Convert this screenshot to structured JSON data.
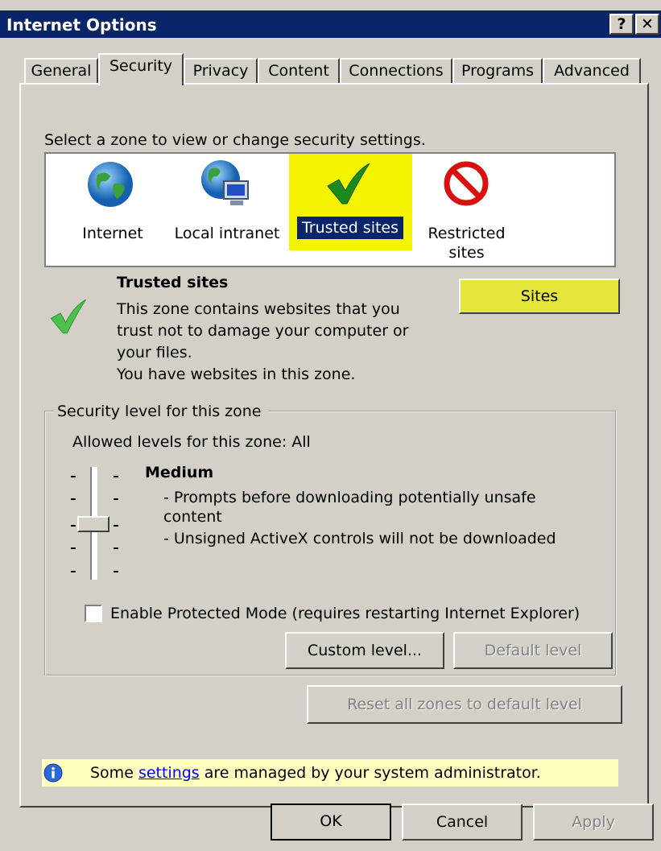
{
  "window": {
    "title": "Internet Options",
    "help_button": "?",
    "close_button": "✕"
  },
  "tabs": [
    "General",
    "Security",
    "Privacy",
    "Content",
    "Connections",
    "Programs",
    "Advanced"
  ],
  "active_tab": "Security",
  "zone_prompt": "Select a zone to view or change security settings.",
  "zones": [
    {
      "label": "Internet",
      "icon": "globe-icon"
    },
    {
      "label": "Local intranet",
      "icon": "intranet-icon"
    },
    {
      "label": "Trusted sites",
      "icon": "checkmark-icon",
      "selected": true
    },
    {
      "label": "Restricted sites",
      "line1": "Restricted",
      "line2": "sites",
      "icon": "restricted-icon"
    }
  ],
  "zone_info": {
    "title": "Trusted sites",
    "desc_lines": [
      "This zone contains websites that you",
      "trust not to damage your computer or",
      "your files.",
      "You have websites in this zone."
    ],
    "sites_button": "Sites"
  },
  "security_level": {
    "group_label": "Security level for this zone",
    "allowed": "Allowed levels for this zone: All",
    "level_name": "Medium",
    "desc_lines": [
      "- Prompts before downloading potentially unsafe",
      "content",
      "- Unsigned ActiveX controls will not be downloaded"
    ],
    "slider_level_index": 2,
    "slider_level_count": 5
  },
  "protected_mode": {
    "label": "Enable Protected Mode (requires restarting Internet Explorer)",
    "checked": false
  },
  "buttons": {
    "custom_level": "Custom level...",
    "default_level": "Default level",
    "reset_all": "Reset all zones to default level",
    "ok": "OK",
    "cancel": "Cancel",
    "apply": "Apply"
  },
  "info_bar": {
    "before": "Some ",
    "link": "settings",
    "after": " are managed by your system administrator."
  },
  "colors": {
    "highlight": "#f4f400",
    "titlebar": "#0a246a",
    "dialog_bg": "#d4d0c8",
    "selected_label_bg": "#0a246a"
  }
}
